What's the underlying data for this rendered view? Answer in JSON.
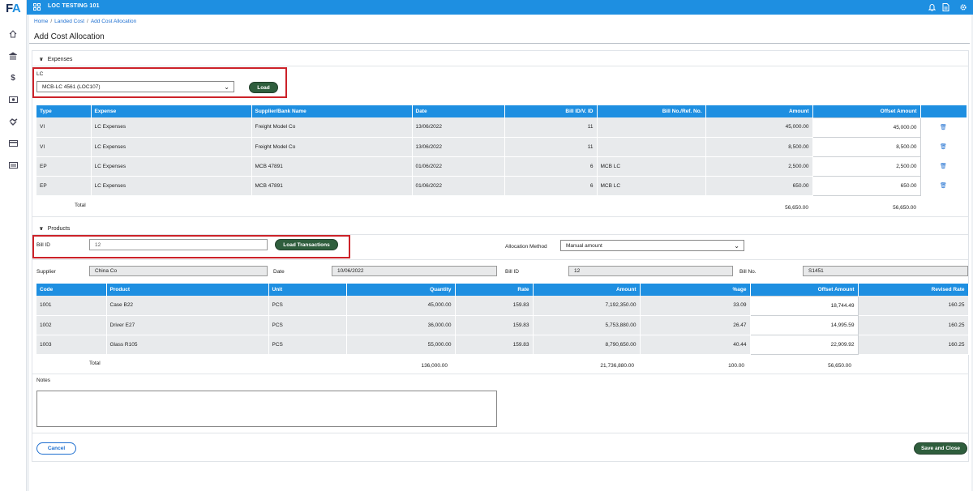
{
  "app": {
    "logo_f": "F",
    "logo_a": "A",
    "title": "LOC TESTING 101"
  },
  "sidebar": {
    "icons": [
      "home-icon",
      "bank-icon",
      "dollar-icon",
      "cash-icon",
      "handshake-icon",
      "card-icon",
      "id-card-icon"
    ]
  },
  "topbar": {
    "icons": [
      "bell-icon",
      "document-icon",
      "gear-icon"
    ]
  },
  "breadcrumb": [
    "Home",
    "Landed Cost",
    "Add Cost Allocation"
  ],
  "page_title": "Add Cost Allocation",
  "expenses": {
    "section_label": "Expenses",
    "lc_label": "LC",
    "lc_value": "MCB-LC 4561 (LOC107)",
    "load_label": "Load",
    "columns": [
      "Type",
      "Expense",
      "Supplier/Bank Name",
      "Date",
      "Bill ID/V. ID",
      "Bill No./Ref. No.",
      "Amount",
      "Offset Amount"
    ],
    "rows": [
      {
        "type": "VI",
        "expense": "LC Expenses",
        "supplier": "Freight Model Co",
        "date": "13/06/2022",
        "bill_id": "11",
        "bill_no": "",
        "amount": "45,000.00",
        "offset": "45,000.00"
      },
      {
        "type": "VI",
        "expense": "LC Expenses",
        "supplier": "Freight Model Co",
        "date": "13/06/2022",
        "bill_id": "11",
        "bill_no": "",
        "amount": "8,500.00",
        "offset": "8,500.00"
      },
      {
        "type": "EP",
        "expense": "LC Expenses",
        "supplier": "MCB 47891",
        "date": "01/06/2022",
        "bill_id": "6",
        "bill_no": "MCB LC",
        "amount": "2,500.00",
        "offset": "2,500.00"
      },
      {
        "type": "EP",
        "expense": "LC Expenses",
        "supplier": "MCB 47891",
        "date": "01/06/2022",
        "bill_id": "6",
        "bill_no": "MCB LC",
        "amount": "650.00",
        "offset": "650.00"
      }
    ],
    "total_label": "Total",
    "total_amount": "56,650.00",
    "total_offset": "56,650.00"
  },
  "products": {
    "section_label": "Products",
    "bill_id_label": "Bill ID",
    "bill_id_value": "12",
    "load_transactions_label": "Load Transactions",
    "allocation_method_label": "Allocation Method",
    "allocation_method_value": "Manual amount",
    "supplier_label": "Supplier",
    "supplier_value": "China Co",
    "date_label": "Date",
    "date_value": "10/06/2022",
    "bill_id2_label": "Bill ID",
    "bill_id2_value": "12",
    "bill_no_label": "Bill No.",
    "bill_no_value": "S1451",
    "columns": [
      "Code",
      "Product",
      "Unit",
      "Quantity",
      "Rate",
      "Amount",
      "%age",
      "Offset Amount",
      "Revised Rate"
    ],
    "rows": [
      {
        "code": "1001",
        "product": "Case B22",
        "unit": "PCS",
        "quantity": "45,000.00",
        "rate": "159.83",
        "amount": "7,192,350.00",
        "pct": "33.09",
        "offset": "18,744.49",
        "revised": "160.25"
      },
      {
        "code": "1002",
        "product": "Driver E27",
        "unit": "PCS",
        "quantity": "36,000.00",
        "rate": "159.83",
        "amount": "5,753,880.00",
        "pct": "26.47",
        "offset": "14,995.59",
        "revised": "160.25"
      },
      {
        "code": "1003",
        "product": "Glass R105",
        "unit": "PCS",
        "quantity": "55,000.00",
        "rate": "159.83",
        "amount": "8,790,650.00",
        "pct": "40.44",
        "offset": "22,909.92",
        "revised": "160.25"
      }
    ],
    "total_label": "Total",
    "total_quantity": "136,000.00",
    "total_amount": "21,736,880.00",
    "total_pct": "100.00",
    "total_offset": "56,650.00"
  },
  "notes_label": "Notes",
  "cancel_label": "Cancel",
  "save_label": "Save and Close"
}
